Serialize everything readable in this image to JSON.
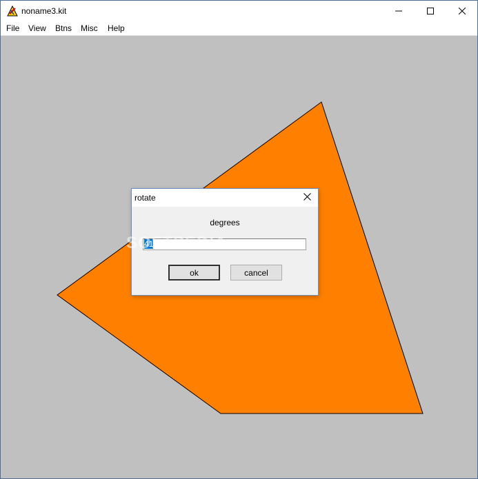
{
  "window": {
    "title": "noname3.kit"
  },
  "menu": {
    "items": [
      "File",
      "View",
      "Btns",
      "Misc",
      "Help"
    ]
  },
  "canvas": {
    "background": "#c0c0c0",
    "shape_fill": "#ff8000"
  },
  "dialog": {
    "title": "rotate",
    "label": "degrees",
    "input_value": "41",
    "ok_label": "ok",
    "cancel_label": "cancel"
  },
  "watermark": "SOFTPEDIA",
  "icons": {
    "app": "app-icon",
    "minimize": "minimize-icon",
    "maximize": "maximize-icon",
    "close": "close-icon"
  }
}
